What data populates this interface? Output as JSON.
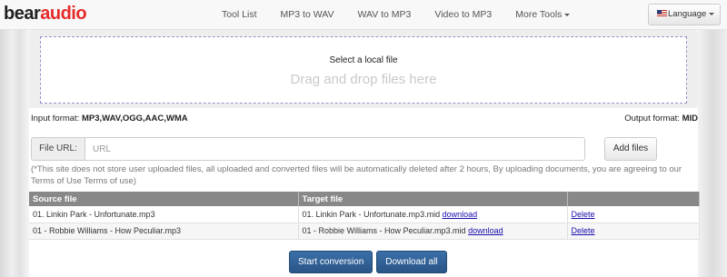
{
  "brand": {
    "logo_part1": "bear",
    "logo_part2": "audio"
  },
  "nav": {
    "items": [
      "Tool List",
      "MP3 to WAV",
      "WAV to MP3",
      "Video to MP3",
      "More Tools"
    ],
    "language_label": "Language"
  },
  "upload": {
    "select_label": "Select a local file",
    "drag_hint": "Drag and drop files here"
  },
  "formats": {
    "input_label": "Input format:",
    "input_value": "MP3,WAV,OGG,AAC,WMA",
    "output_label": "Output format:",
    "output_value": "MID"
  },
  "url_row": {
    "label": "File URL:",
    "placeholder": "URL",
    "add_button": "Add files"
  },
  "notice": "(*This site does not store user uploaded files, all uploaded and converted files will be automatically deleted after 2 hours, By uploading documents, you are agreeing to our Terms of Use Terms of use)",
  "table": {
    "headers": [
      "Source file",
      "Target file",
      ""
    ],
    "rows": [
      {
        "source": "01. Linkin Park - Unfortunate.mp3",
        "target": "01. Linkin Park - Unfortunate.mp3.mid",
        "download": "download",
        "delete": "Delete"
      },
      {
        "source": "01 - Robbie Williams - How Peculiar.mp3",
        "target": "01 - Robbie Williams - How Peculiar.mp3.mid",
        "download": "download",
        "delete": "Delete"
      }
    ]
  },
  "actions": {
    "start": "Start conversion",
    "download_all": "Download all"
  }
}
